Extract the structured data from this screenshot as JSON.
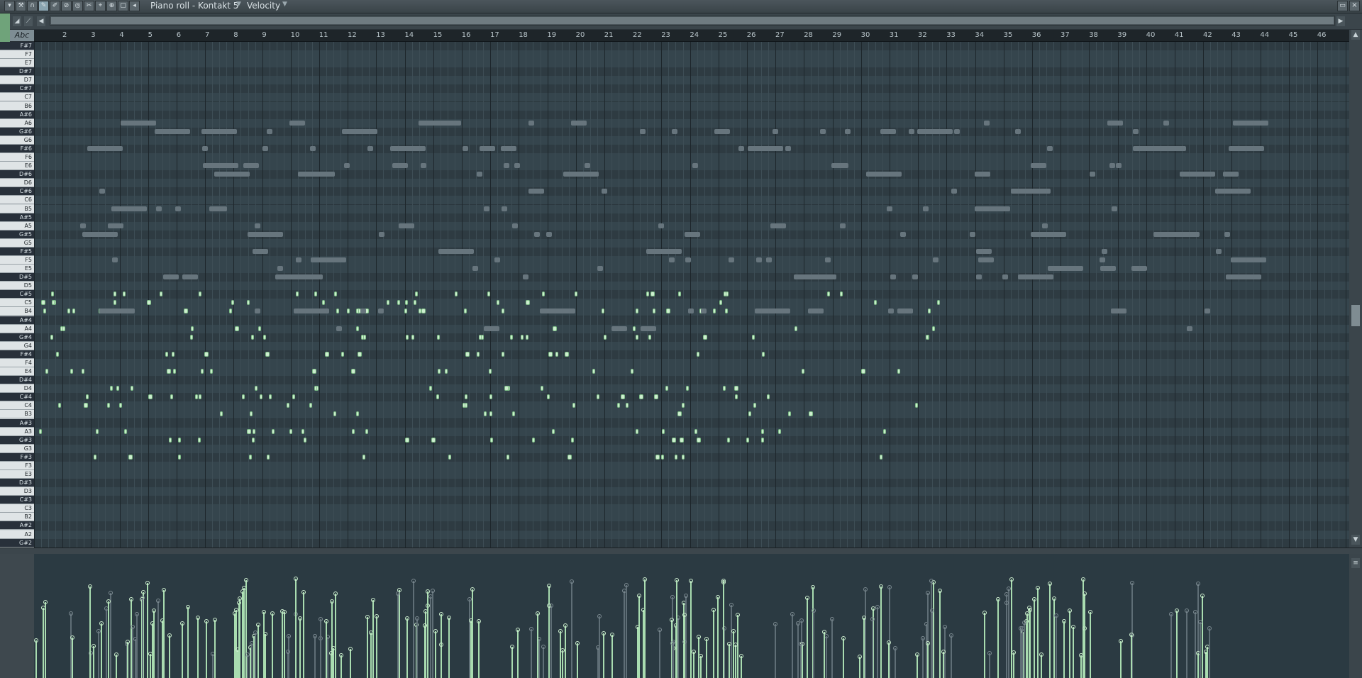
{
  "window": {
    "title": "Piano roll - Kontakt 5",
    "target": "Velocity",
    "colors": {
      "accent_green": "#cdeecf",
      "ghost": "#67757d",
      "grid_bg": "#34434b",
      "panel": "#3b454b"
    }
  },
  "toolbar": {
    "icons": [
      "menu-arrow-icon",
      "wrench-icon",
      "magnet-icon",
      "pencil-icon",
      "brush-icon",
      "delete-icon",
      "mute-icon",
      "slice-icon",
      "select-icon",
      "zoom-icon",
      "playback-icon",
      "speaker-icon"
    ],
    "labels": [
      "▾",
      "⚒",
      "∩",
      "✎",
      "✐",
      "⊘",
      "◎",
      "✂",
      "⌖",
      "⊕",
      "▢",
      "◂"
    ]
  },
  "ruler": {
    "bars": [
      "2",
      "3",
      "4",
      "5",
      "6",
      "7",
      "8",
      "9",
      "10",
      "11",
      "12",
      "13",
      "14",
      "15",
      "16",
      "17",
      "18",
      "19",
      "20",
      "21",
      "22",
      "23",
      "24",
      "25",
      "26",
      "27",
      "28",
      "29",
      "30",
      "31",
      "32",
      "33",
      "34",
      "35",
      "36",
      "37",
      "38",
      "39",
      "40",
      "41",
      "42",
      "43",
      "44",
      "45",
      "46"
    ],
    "abc_label": "Abc"
  },
  "keys": [
    "F#7",
    "F7",
    "E7",
    "D#7",
    "D7",
    "C#7",
    "C7",
    "B6",
    "A#6",
    "A6",
    "G#6",
    "G6",
    "F#6",
    "F6",
    "E6",
    "D#6",
    "D6",
    "C#6",
    "C6",
    "B5",
    "A#5",
    "A5",
    "G#5",
    "G5",
    "F#5",
    "F5",
    "E5",
    "D#5",
    "D5",
    "C#5",
    "C5",
    "B4",
    "A#4",
    "A4",
    "G#4",
    "G4",
    "F#4",
    "F4",
    "E4",
    "D#4",
    "D4",
    "C#4",
    "C4",
    "B3",
    "A#3",
    "A3",
    "G#3",
    "G3",
    "F#3",
    "F3",
    "E3",
    "D#3",
    "D3",
    "C#3",
    "C3",
    "B2",
    "A#2",
    "A2",
    "G#2"
  ]
}
